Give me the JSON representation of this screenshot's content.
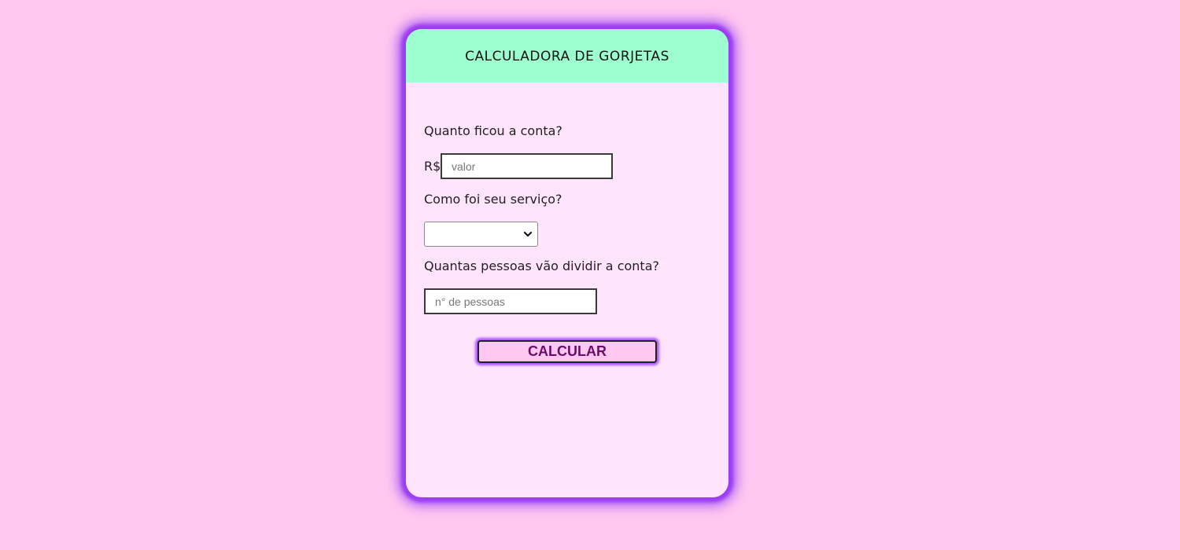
{
  "header": {
    "title": "CALCULADORA DE GORJETAS"
  },
  "form": {
    "bill_label": "Quanto ficou a conta?",
    "currency_symbol": "R$",
    "bill_placeholder": "valor",
    "bill_value": "",
    "service_label": "Como foi seu serviço?",
    "service_selected": "",
    "people_label": "Quantas pessoas vão dividir a conta?",
    "people_placeholder": "n° de pessoas",
    "people_value": "",
    "calculate_label": "CALCULAR"
  },
  "colors": {
    "page_background": "#ffc8f0",
    "card_background": "#ffe4fc",
    "header_background": "#9dffd0",
    "glow": "#a855f7",
    "button_text": "#6a0d6a"
  },
  "icons": {
    "select_arrow": "chevron-down-icon"
  }
}
